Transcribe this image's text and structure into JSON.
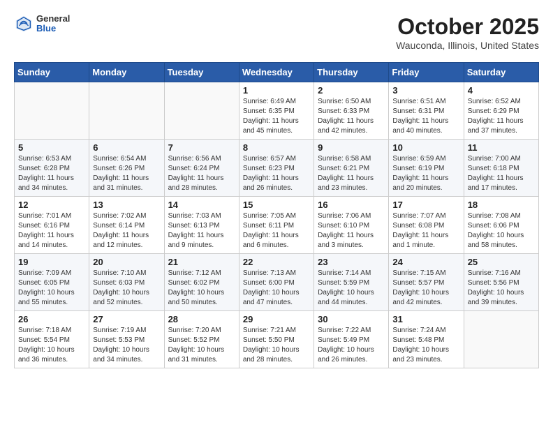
{
  "header": {
    "logo_general": "General",
    "logo_blue": "Blue",
    "month_title": "October 2025",
    "location": "Wauconda, Illinois, United States"
  },
  "days_of_week": [
    "Sunday",
    "Monday",
    "Tuesday",
    "Wednesday",
    "Thursday",
    "Friday",
    "Saturday"
  ],
  "weeks": [
    [
      {
        "day": "",
        "info": ""
      },
      {
        "day": "",
        "info": ""
      },
      {
        "day": "",
        "info": ""
      },
      {
        "day": "1",
        "info": "Sunrise: 6:49 AM\nSunset: 6:35 PM\nDaylight: 11 hours\nand 45 minutes."
      },
      {
        "day": "2",
        "info": "Sunrise: 6:50 AM\nSunset: 6:33 PM\nDaylight: 11 hours\nand 42 minutes."
      },
      {
        "day": "3",
        "info": "Sunrise: 6:51 AM\nSunset: 6:31 PM\nDaylight: 11 hours\nand 40 minutes."
      },
      {
        "day": "4",
        "info": "Sunrise: 6:52 AM\nSunset: 6:29 PM\nDaylight: 11 hours\nand 37 minutes."
      }
    ],
    [
      {
        "day": "5",
        "info": "Sunrise: 6:53 AM\nSunset: 6:28 PM\nDaylight: 11 hours\nand 34 minutes."
      },
      {
        "day": "6",
        "info": "Sunrise: 6:54 AM\nSunset: 6:26 PM\nDaylight: 11 hours\nand 31 minutes."
      },
      {
        "day": "7",
        "info": "Sunrise: 6:56 AM\nSunset: 6:24 PM\nDaylight: 11 hours\nand 28 minutes."
      },
      {
        "day": "8",
        "info": "Sunrise: 6:57 AM\nSunset: 6:23 PM\nDaylight: 11 hours\nand 26 minutes."
      },
      {
        "day": "9",
        "info": "Sunrise: 6:58 AM\nSunset: 6:21 PM\nDaylight: 11 hours\nand 23 minutes."
      },
      {
        "day": "10",
        "info": "Sunrise: 6:59 AM\nSunset: 6:19 PM\nDaylight: 11 hours\nand 20 minutes."
      },
      {
        "day": "11",
        "info": "Sunrise: 7:00 AM\nSunset: 6:18 PM\nDaylight: 11 hours\nand 17 minutes."
      }
    ],
    [
      {
        "day": "12",
        "info": "Sunrise: 7:01 AM\nSunset: 6:16 PM\nDaylight: 11 hours\nand 14 minutes."
      },
      {
        "day": "13",
        "info": "Sunrise: 7:02 AM\nSunset: 6:14 PM\nDaylight: 11 hours\nand 12 minutes."
      },
      {
        "day": "14",
        "info": "Sunrise: 7:03 AM\nSunset: 6:13 PM\nDaylight: 11 hours\nand 9 minutes."
      },
      {
        "day": "15",
        "info": "Sunrise: 7:05 AM\nSunset: 6:11 PM\nDaylight: 11 hours\nand 6 minutes."
      },
      {
        "day": "16",
        "info": "Sunrise: 7:06 AM\nSunset: 6:10 PM\nDaylight: 11 hours\nand 3 minutes."
      },
      {
        "day": "17",
        "info": "Sunrise: 7:07 AM\nSunset: 6:08 PM\nDaylight: 11 hours\nand 1 minute."
      },
      {
        "day": "18",
        "info": "Sunrise: 7:08 AM\nSunset: 6:06 PM\nDaylight: 10 hours\nand 58 minutes."
      }
    ],
    [
      {
        "day": "19",
        "info": "Sunrise: 7:09 AM\nSunset: 6:05 PM\nDaylight: 10 hours\nand 55 minutes."
      },
      {
        "day": "20",
        "info": "Sunrise: 7:10 AM\nSunset: 6:03 PM\nDaylight: 10 hours\nand 52 minutes."
      },
      {
        "day": "21",
        "info": "Sunrise: 7:12 AM\nSunset: 6:02 PM\nDaylight: 10 hours\nand 50 minutes."
      },
      {
        "day": "22",
        "info": "Sunrise: 7:13 AM\nSunset: 6:00 PM\nDaylight: 10 hours\nand 47 minutes."
      },
      {
        "day": "23",
        "info": "Sunrise: 7:14 AM\nSunset: 5:59 PM\nDaylight: 10 hours\nand 44 minutes."
      },
      {
        "day": "24",
        "info": "Sunrise: 7:15 AM\nSunset: 5:57 PM\nDaylight: 10 hours\nand 42 minutes."
      },
      {
        "day": "25",
        "info": "Sunrise: 7:16 AM\nSunset: 5:56 PM\nDaylight: 10 hours\nand 39 minutes."
      }
    ],
    [
      {
        "day": "26",
        "info": "Sunrise: 7:18 AM\nSunset: 5:54 PM\nDaylight: 10 hours\nand 36 minutes."
      },
      {
        "day": "27",
        "info": "Sunrise: 7:19 AM\nSunset: 5:53 PM\nDaylight: 10 hours\nand 34 minutes."
      },
      {
        "day": "28",
        "info": "Sunrise: 7:20 AM\nSunset: 5:52 PM\nDaylight: 10 hours\nand 31 minutes."
      },
      {
        "day": "29",
        "info": "Sunrise: 7:21 AM\nSunset: 5:50 PM\nDaylight: 10 hours\nand 28 minutes."
      },
      {
        "day": "30",
        "info": "Sunrise: 7:22 AM\nSunset: 5:49 PM\nDaylight: 10 hours\nand 26 minutes."
      },
      {
        "day": "31",
        "info": "Sunrise: 7:24 AM\nSunset: 5:48 PM\nDaylight: 10 hours\nand 23 minutes."
      },
      {
        "day": "",
        "info": ""
      }
    ]
  ]
}
